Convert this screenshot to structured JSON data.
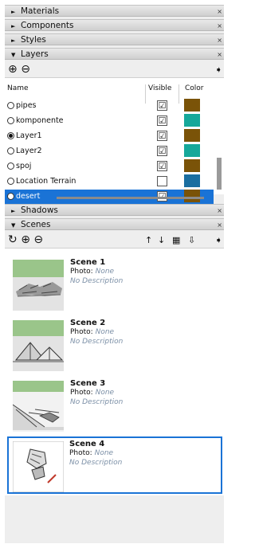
{
  "panels": {
    "materials": {
      "label": "Materials",
      "arrow": "►",
      "close": "×"
    },
    "components": {
      "label": "Components",
      "arrow": "►",
      "close": "×"
    },
    "styles": {
      "label": "Styles",
      "arrow": "►",
      "close": "×"
    },
    "layers": {
      "label": "Layers",
      "arrow": "▼",
      "close": "×"
    },
    "shadows": {
      "label": "Shadows",
      "arrow": "►",
      "close": "×"
    },
    "scenes": {
      "label": "Scenes",
      "arrow": "▼",
      "close": "×"
    }
  },
  "layers": {
    "columns": {
      "name": "Name",
      "visible": "Visible",
      "color": "Color"
    },
    "rows": [
      {
        "name": "pipes",
        "active": false,
        "visible": true,
        "color": "#7a5308",
        "selected": false
      },
      {
        "name": "komponente",
        "active": false,
        "visible": true,
        "color": "#16a89a",
        "selected": false
      },
      {
        "name": "Layer1",
        "active": true,
        "visible": true,
        "color": "#7a5308",
        "selected": false
      },
      {
        "name": "Layer2",
        "active": false,
        "visible": true,
        "color": "#16a89a",
        "selected": false
      },
      {
        "name": "spoj",
        "active": false,
        "visible": true,
        "color": "#7a5308",
        "selected": false
      },
      {
        "name": "Location Terrain",
        "active": false,
        "visible": false,
        "color": "#1a6ea0",
        "selected": false
      },
      {
        "name": "desert",
        "active": false,
        "visible": true,
        "color": "#7a5308",
        "selected": true
      }
    ]
  },
  "icons": {
    "add": "⊕",
    "remove": "⊖",
    "details": "➧",
    "refresh": "↻",
    "move_up": "↑",
    "move_down": "↓",
    "view_options": "▦",
    "update": "⇩",
    "check": "☑"
  },
  "scenes": {
    "photo_label": "Photo:",
    "items": [
      {
        "title": "Scene 1",
        "photo": "None",
        "desc": "No Description",
        "selected": false
      },
      {
        "title": "Scene 2",
        "photo": "None",
        "desc": "No Description",
        "selected": false
      },
      {
        "title": "Scene 3",
        "photo": "None",
        "desc": "No Description",
        "selected": false
      },
      {
        "title": "Scene 4",
        "photo": "None",
        "desc": "No Description",
        "selected": true
      }
    ]
  },
  "colors": {
    "selection": "#1a73d6"
  }
}
